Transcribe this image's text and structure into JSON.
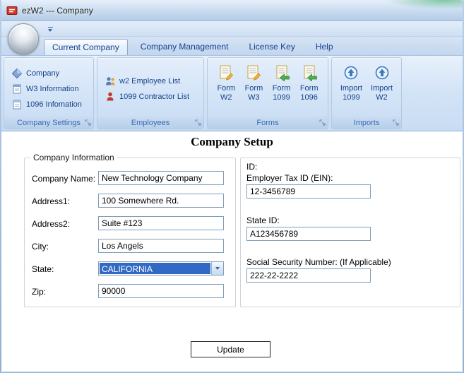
{
  "window": {
    "title": "ezW2 --- Company"
  },
  "tabs": [
    {
      "label": "Current Company"
    },
    {
      "label": "Company Management"
    },
    {
      "label": "License Key"
    },
    {
      "label": "Help"
    }
  ],
  "ribbon": {
    "company_settings": {
      "caption": "Company Settings",
      "items": [
        {
          "label": "Company",
          "icon": "company-icon"
        },
        {
          "label": "W3 Information",
          "icon": "w3-document-icon"
        },
        {
          "label": "1096 Infomation",
          "icon": "1096-document-icon"
        }
      ]
    },
    "employees": {
      "caption": "Employees",
      "items": [
        {
          "label": "w2 Employee List",
          "icon": "employees-icon"
        },
        {
          "label": "1099 Contractor List",
          "icon": "contractor-icon"
        }
      ]
    },
    "forms": {
      "caption": "Forms",
      "items": [
        {
          "line1": "Form",
          "line2": "W2",
          "icon": "form-pencil-icon"
        },
        {
          "line1": "Form",
          "line2": "W3",
          "icon": "form-pencil-icon"
        },
        {
          "line1": "Form",
          "line2": "1099",
          "icon": "form-arrow-icon"
        },
        {
          "line1": "Form",
          "line2": "1096",
          "icon": "form-arrow-icon"
        }
      ]
    },
    "imports": {
      "caption": "Imports",
      "items": [
        {
          "line1": "Import",
          "line2": "1099",
          "icon": "import-icon"
        },
        {
          "line1": "Import",
          "line2": "W2",
          "icon": "import-icon"
        }
      ]
    }
  },
  "content": {
    "title": "Company Setup",
    "company_info": {
      "legend": "Company Information",
      "company_name": {
        "label": "Company Name:",
        "value": "New Technology Company"
      },
      "address1": {
        "label": "Address1:",
        "value": "100 Somewhere Rd."
      },
      "address2": {
        "label": "Address2:",
        "value": "Suite #123"
      },
      "city": {
        "label": "City:",
        "value": "Los Angels"
      },
      "state": {
        "label": "State:",
        "value": "CALIFORNIA"
      },
      "zip": {
        "label": "Zip:",
        "value": "90000"
      }
    },
    "id_section": {
      "heading": "ID:",
      "ein": {
        "label": "Employer Tax ID (EIN):",
        "value": "12-3456789"
      },
      "state_id": {
        "label": "State ID:",
        "value": "A123456789"
      },
      "ssn": {
        "label": "Social Security Number: (If Applicable)",
        "value": "222-22-2222"
      }
    },
    "update_label": "Update"
  },
  "colors": {
    "accent_blue": "#15428b",
    "selection_blue": "#316ac5",
    "ribbon_light": "#dbe9fa",
    "titlebar_blue": "#c8dbef",
    "app_icon_red": "#d63a2a"
  }
}
